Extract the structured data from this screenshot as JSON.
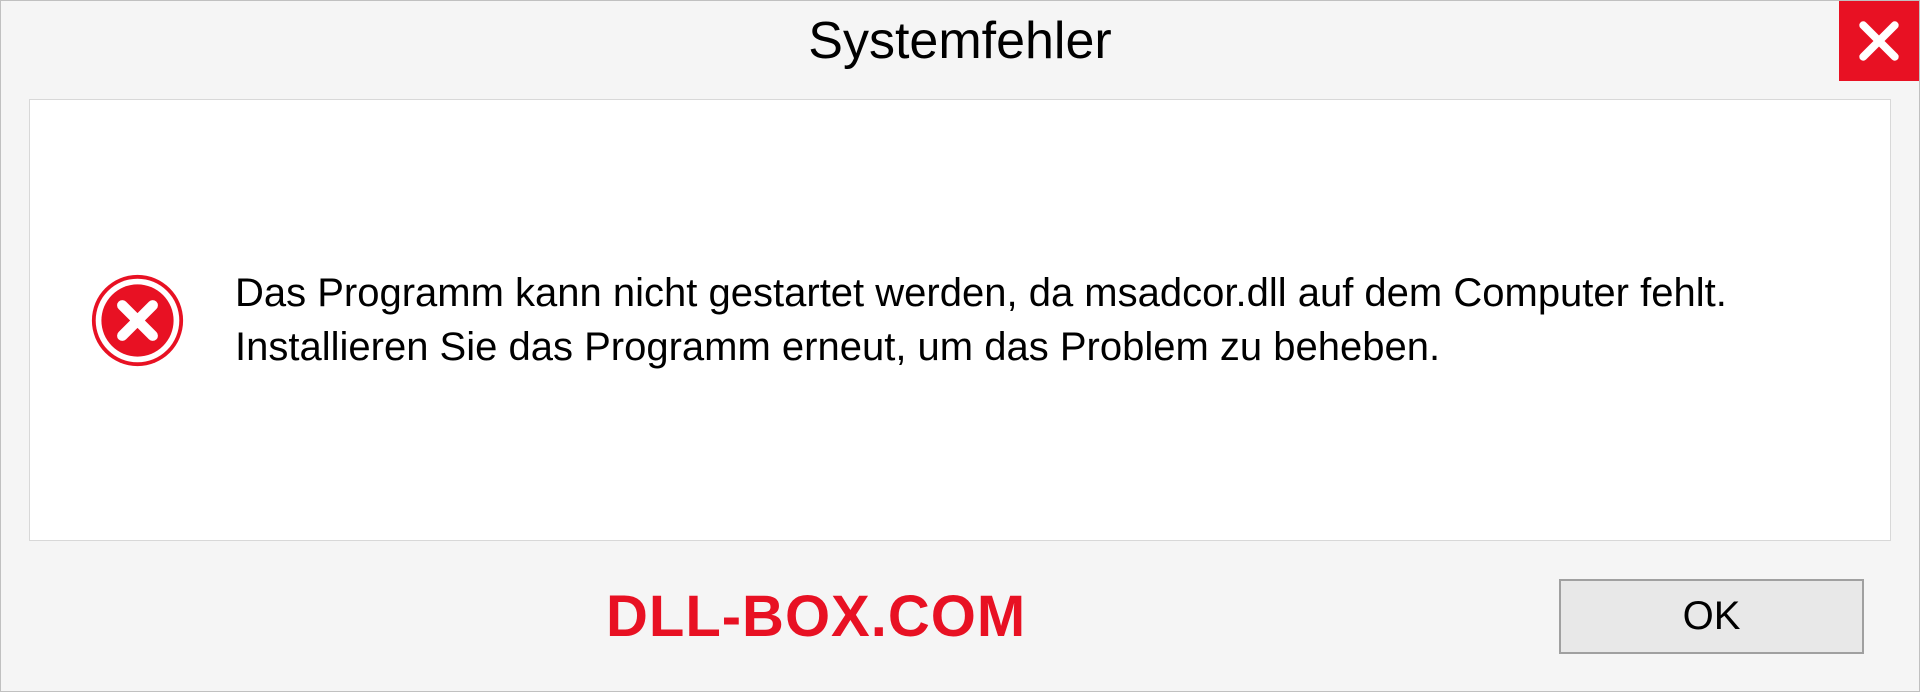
{
  "dialog": {
    "title": "Systemfehler",
    "message": "Das Programm kann nicht gestartet werden, da msadcor.dll auf dem Computer fehlt. Installieren Sie das Programm erneut, um das Problem zu beheben.",
    "ok_label": "OK",
    "watermark": "DLL-BOX.COM"
  }
}
